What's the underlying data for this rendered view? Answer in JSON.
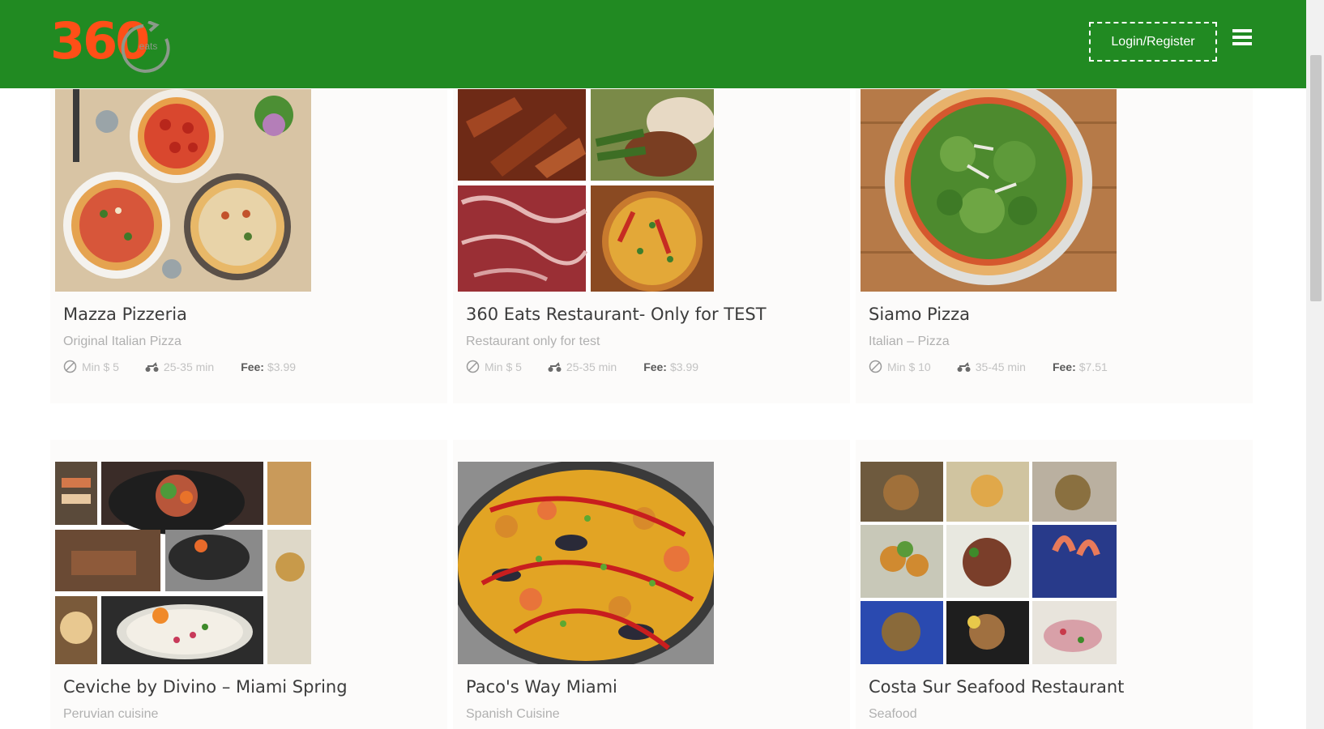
{
  "header": {
    "logo_digits": "360",
    "logo_word": "eats",
    "login_label": "Login/Register",
    "brand_color": "#218a22",
    "logo_color": "#ff4f17"
  },
  "restaurants": [
    {
      "name": "Mazza Pizzeria",
      "subtitle": "Original Italian Pizza",
      "min_order": "Min $ 5",
      "delivery_time": "25-35 min",
      "fee_label": "Fee:",
      "fee": "$3.99",
      "image_icon": "pizza-photo"
    },
    {
      "name": "360 Eats Restaurant- Only for TEST",
      "subtitle": "Restaurant only for test",
      "min_order": "Min $ 5",
      "delivery_time": "25-35 min",
      "fee_label": "Fee:",
      "fee": "$3.99",
      "image_icon": "food-collage-photo"
    },
    {
      "name": "Siamo Pizza",
      "subtitle": "Italian – Pizza",
      "min_order": "Min $ 10",
      "delivery_time": "35-45 min",
      "fee_label": "Fee:",
      "fee": "$7.51",
      "image_icon": "arugula-pizza-photo"
    },
    {
      "name": "Ceviche by Divino – Miami Spring",
      "subtitle": "Peruvian cuisine",
      "image_icon": "ceviche-collage-photo"
    },
    {
      "name": "Paco's Way Miami",
      "subtitle": "Spanish Cuisine",
      "image_icon": "paella-photo"
    },
    {
      "name": "Costa Sur Seafood Restaurant",
      "subtitle": "Seafood",
      "image_icon": "seafood-collage-photo"
    }
  ]
}
